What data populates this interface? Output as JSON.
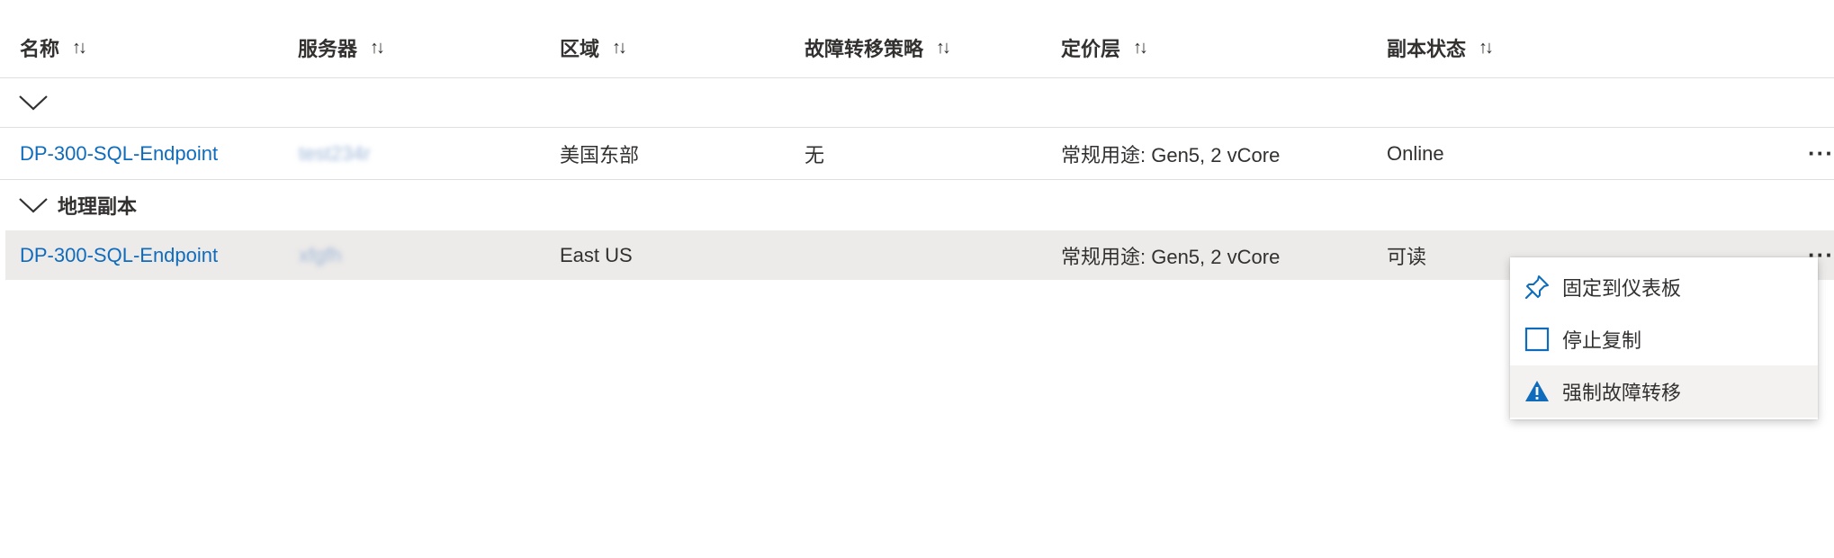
{
  "columns": [
    {
      "label": "名称"
    },
    {
      "label": "服务器"
    },
    {
      "label": "区域"
    },
    {
      "label": "故障转移策略"
    },
    {
      "label": "定价层"
    },
    {
      "label": "副本状态"
    }
  ],
  "sort_glyph": "↑↓",
  "groups": [
    {
      "label": "",
      "rows": [
        {
          "name": "DP-300-SQL-Endpoint",
          "server": "test234r",
          "region": "美国东部",
          "failover": "无",
          "tier": "常规用途: Gen5, 2 vCore",
          "status": "Online"
        }
      ]
    },
    {
      "label": "地理副本",
      "rows": [
        {
          "name": "DP-300-SQL-Endpoint",
          "server": "xfgfh",
          "region": "East US",
          "failover": "",
          "tier": "常规用途: Gen5, 2 vCore",
          "status": "可读"
        }
      ]
    }
  ],
  "more_glyph": "···",
  "context_menu": {
    "items": [
      {
        "label": "固定到仪表板",
        "icon": "pin-icon"
      },
      {
        "label": "停止复制",
        "icon": "checkbox-icon"
      },
      {
        "label": "强制故障转移",
        "icon": "warning-icon"
      }
    ]
  },
  "colors": {
    "link": "#0f6cbd",
    "selected_row": "#edebe9",
    "warning_icon": "#0f6cbd"
  }
}
